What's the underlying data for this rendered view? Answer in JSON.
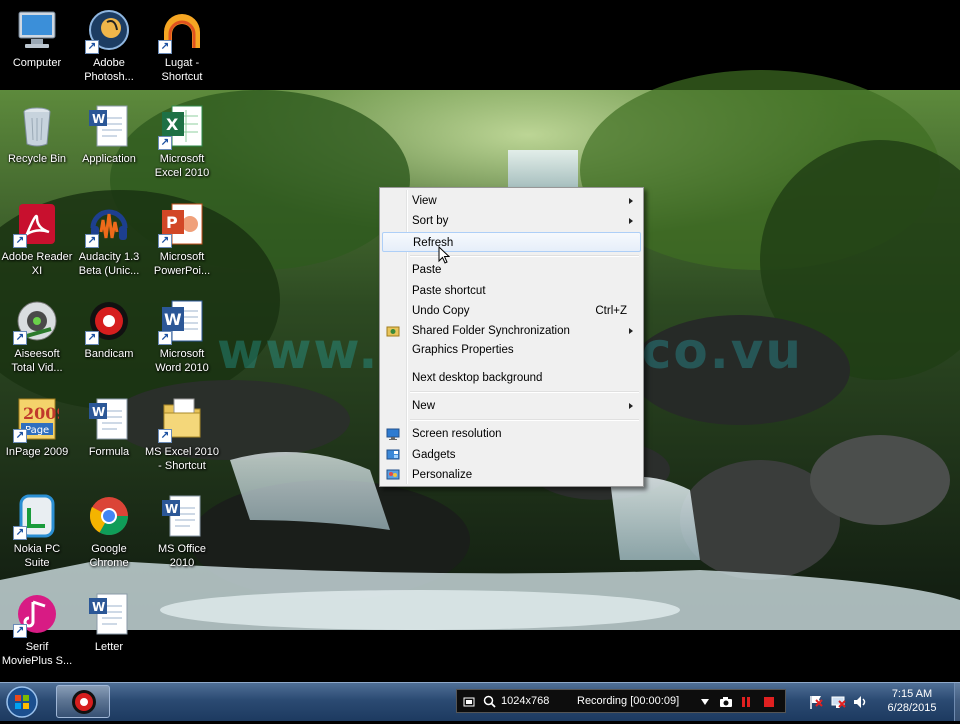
{
  "desktop": {
    "icons": [
      {
        "label": "Computer"
      },
      {
        "label": "Adobe\nPhotosh..."
      },
      {
        "label": "Lugat -\nShortcut"
      },
      {
        "label": "Recycle Bin"
      },
      {
        "label": "Application"
      },
      {
        "label": "Microsoft\nExcel 2010"
      },
      {
        "label": "Adobe Reader\nXI"
      },
      {
        "label": "Audacity 1.3\nBeta (Unic..."
      },
      {
        "label": "Microsoft\nPowerPoi..."
      },
      {
        "label": "Aiseesoft\nTotal Vid..."
      },
      {
        "label": "Bandicam"
      },
      {
        "label": "Microsoft\nWord 2010"
      },
      {
        "label": "InPage 2009"
      },
      {
        "label": "Formula"
      },
      {
        "label": "MS Excel 2010\n- Shortcut"
      },
      {
        "label": "Nokia PC\nSuite"
      },
      {
        "label": "Google\nChrome"
      },
      {
        "label": "MS Office\n2010"
      },
      {
        "label": "Serif\nMoviePlus S..."
      },
      {
        "label": "Letter"
      }
    ],
    "watermark": "www.Groofun.co.vu"
  },
  "context_menu": {
    "items": [
      {
        "label": "View"
      },
      {
        "label": "Sort by"
      },
      {
        "label": "Refresh"
      },
      {
        "label": "Paste"
      },
      {
        "label": "Paste shortcut"
      },
      {
        "label": "Undo Copy",
        "shortcut": "Ctrl+Z"
      },
      {
        "label": "Shared Folder Synchronization"
      },
      {
        "label": "Graphics Properties"
      },
      {
        "label": "Next desktop background"
      },
      {
        "label": "New"
      },
      {
        "label": "Screen resolution"
      },
      {
        "label": "Gadgets"
      },
      {
        "label": "Personalize"
      }
    ]
  },
  "taskbar": {
    "recorder": {
      "resolution": "1024x768",
      "status": "Recording [00:00:09]"
    },
    "clock": {
      "time": "7:15 AM",
      "date": "6/28/2015"
    }
  }
}
